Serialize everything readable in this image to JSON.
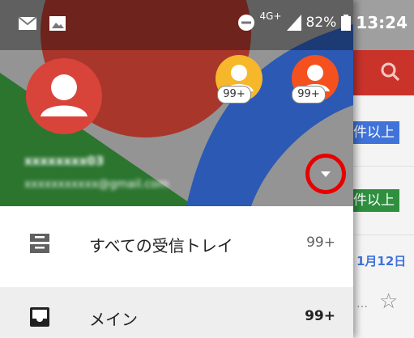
{
  "status_bar": {
    "network": "4G+",
    "battery": "82%",
    "time": "13:24",
    "icons": [
      "mail-icon",
      "image-icon",
      "dnd-icon",
      "signal-icon",
      "battery-icon"
    ]
  },
  "drawer": {
    "header": {
      "account_name": "xxxxxxxx03",
      "account_email": "xxxxxxxxxxx@gmail.com",
      "alt_accounts": [
        {
          "badge": "99+",
          "color": "#f6b72b"
        },
        {
          "badge": "99+",
          "color": "#f4511e"
        }
      ]
    },
    "items": [
      {
        "label": "すべての受信トレイ",
        "count": "99+",
        "icon": "all-inboxes-icon"
      },
      {
        "label": "メイン",
        "count": "99+",
        "icon": "inbox-icon"
      }
    ]
  },
  "background_app": {
    "tags": [
      "件以上",
      "件以上"
    ],
    "date": "1月12日",
    "snippet": "…",
    "accent": "#c9332a"
  }
}
